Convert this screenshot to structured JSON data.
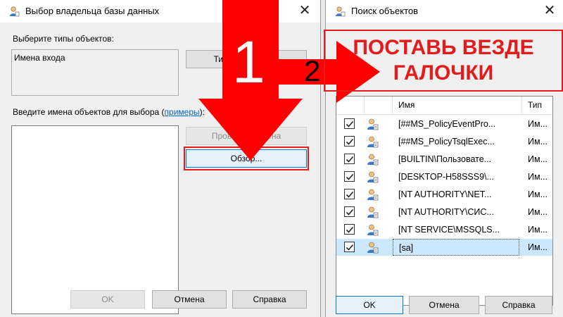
{
  "window1": {
    "title": "Выбор владельца базы данных",
    "object_types_label": "Выберите типы объектов:",
    "object_types_value": "Имена входа",
    "types_button": "Типы объектов...",
    "enter_names_label": "Введите имена объектов для выбора (",
    "examples_link": "примеры",
    "enter_names_label_end": "):",
    "names_value": "",
    "check_names_button": "Проверить имена",
    "browse_button": "Обзор...",
    "ok_button": "OK",
    "cancel_button": "Отмена",
    "help_button": "Справка"
  },
  "window2": {
    "title": "Поиск объектов",
    "columns": {
      "name": "Имя",
      "type": "Тип"
    },
    "rows": [
      {
        "name": "[##MS_PolicyEventPro...",
        "type": "Им...",
        "checked": true,
        "selected": false
      },
      {
        "name": "[##MS_PolicyTsqlExec...",
        "type": "Им...",
        "checked": true,
        "selected": false
      },
      {
        "name": "[BUILTIN\\Пользовате...",
        "type": "Им...",
        "checked": true,
        "selected": false
      },
      {
        "name": "[DESKTOP-H58SSS9\\...",
        "type": "Им...",
        "checked": true,
        "selected": false
      },
      {
        "name": "[NT AUTHORITY\\NET...",
        "type": "Им...",
        "checked": true,
        "selected": false
      },
      {
        "name": "[NT AUTHORITY\\СИС...",
        "type": "Им...",
        "checked": true,
        "selected": false
      },
      {
        "name": "[NT SERVICE\\MSSQLS...",
        "type": "Им...",
        "checked": true,
        "selected": false
      },
      {
        "name": "[sa]",
        "type": "Им...",
        "checked": true,
        "selected": true
      }
    ],
    "ok_button": "OK",
    "cancel_button": "Отмена",
    "help_button": "Справка"
  },
  "annotations": {
    "step1": "1",
    "step2": "2",
    "instruction_line1": "ПОСТАВЬ ВЕЗДЕ",
    "instruction_line2": "ГАЛОЧКИ"
  },
  "colors": {
    "accent_red": "#e31b1b",
    "selection": "#cce8ff",
    "link": "#0066cc"
  },
  "icons": {
    "title_icon": "user-icon",
    "row_icon": "user-icon",
    "close_icon": "close-icon",
    "check_icon": "checkmark-icon"
  }
}
